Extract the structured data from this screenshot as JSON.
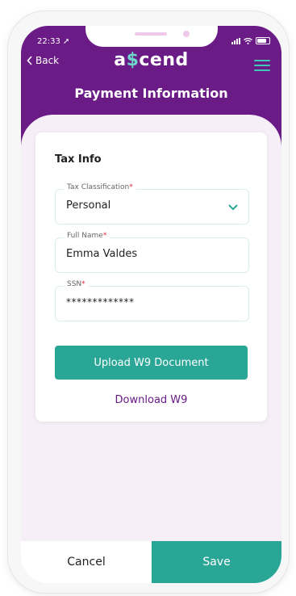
{
  "status_bar": {
    "time": "22:33"
  },
  "nav": {
    "back_label": "Back",
    "logo_prefix": "a",
    "logo_mark": "$",
    "logo_suffix": "cend",
    "page_title": "Payment Information"
  },
  "form": {
    "section_title": "Tax Info",
    "fields": [
      {
        "label": "Tax Classification",
        "required_mark": "*",
        "value": "Personal"
      },
      {
        "label": "Full Name",
        "required_mark": "*",
        "value": "Emma Valdes"
      },
      {
        "label": "SSN",
        "required_mark": "*",
        "value": "*************"
      }
    ],
    "upload_button": "Upload W9 Document",
    "download_link": "Download W9"
  },
  "footer": {
    "cancel_label": "Cancel",
    "save_label": "Save"
  },
  "colors": {
    "primary": "#6a1b86",
    "accent": "#2aa697",
    "background": "#f6eff7"
  }
}
